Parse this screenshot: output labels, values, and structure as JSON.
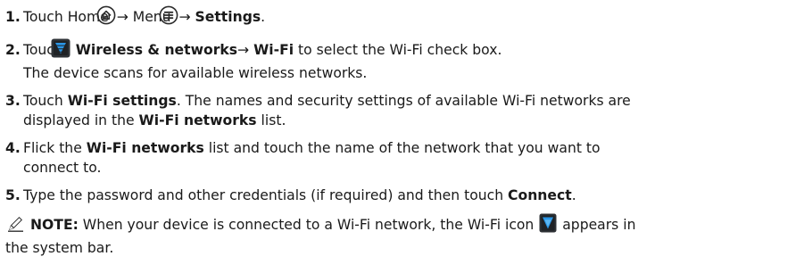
{
  "steps": [
    {
      "num": "1.",
      "t1": "Touch Home ",
      "t2": "→ Menu ",
      "t3": "→ ",
      "b1": "Settings",
      "t4": "."
    },
    {
      "num": "2.",
      "t1": "Touch ",
      "b1": "Wireless & networks",
      "t2": "→ ",
      "b2": "Wi-Fi",
      "t3": " to select the Wi-Fi check box.",
      "line2": "The device scans for available wireless networks."
    },
    {
      "num": "3.",
      "t1": "Touch ",
      "b1": "Wi-Fi settings",
      "t2": ". The names and security settings of available Wi-Fi networks are",
      "t3": "displayed in the ",
      "b2": "Wi-Fi networks",
      "t4": " list."
    },
    {
      "num": "4.",
      "t1": "Flick the ",
      "b1": "Wi-Fi networks",
      "t2": " list and touch the name of the network that you want to",
      "t3": "connect to."
    },
    {
      "num": "5.",
      "t1": "Type the password and other credentials (if required) and then touch ",
      "b1": "Connect",
      "t2": "."
    }
  ],
  "note": {
    "label": "NOTE:",
    "t1": " When your device is connected to a Wi-Fi network, the Wi-Fi icon ",
    "t2": " appears in",
    "t3": "the system bar."
  },
  "icons": {
    "home": "home-icon",
    "menu": "menu-icon",
    "wireless": "wireless-networks-icon",
    "wifi": "wifi-icon",
    "note": "pencil-icon"
  },
  "colors": {
    "text": "#1a1a1a",
    "icon_blue": "#1e88d4",
    "icon_dark": "#2b2b2b"
  }
}
